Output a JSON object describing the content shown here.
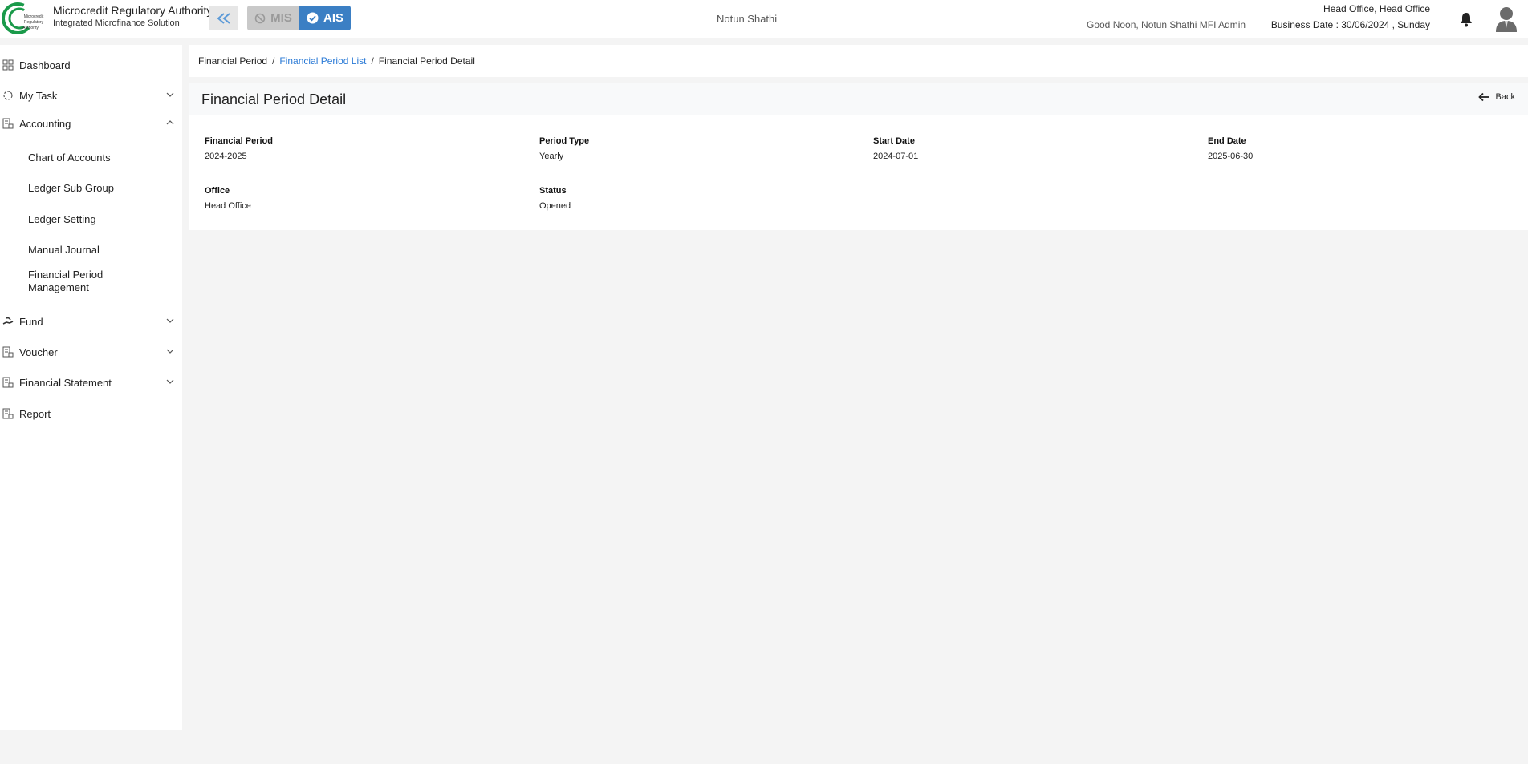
{
  "header": {
    "brand_title": "Microcredit Regulatory Authority",
    "brand_subtitle": "Integrated Microfinance Solution",
    "logo_text": "Microcredit Regulatory Authority",
    "mis_label": "MIS",
    "ais_label": "AIS",
    "org_name": "Notun Shathi",
    "greeting": "Good Noon, Notun Shathi MFI Admin",
    "office": "Head Office, Head Office",
    "business_date": "Business Date : 30/06/2024 , Sunday"
  },
  "sidebar": {
    "items": [
      {
        "label": "Dashboard",
        "icon": "grid-icon"
      },
      {
        "label": "My Task",
        "icon": "spinner-icon"
      },
      {
        "label": "Accounting",
        "icon": "ledger-icon"
      },
      {
        "label": "Fund",
        "icon": "hand-money-icon"
      },
      {
        "label": "Voucher",
        "icon": "ledger-icon"
      },
      {
        "label": "Financial Statement",
        "icon": "ledger-icon"
      },
      {
        "label": "Report",
        "icon": "ledger-icon"
      }
    ],
    "accounting_sub": [
      "Chart of Accounts",
      "Ledger Sub Group",
      "Ledger Setting",
      "Manual Journal",
      "Financial Period Management"
    ]
  },
  "breadcrumb": {
    "root": "Financial Period",
    "list": "Financial Period List",
    "current": "Financial Period Detail",
    "separator": "/"
  },
  "detail": {
    "title": "Financial Period Detail",
    "back_label": "Back",
    "fields": [
      {
        "label": "Financial Period",
        "value": "2024-2025"
      },
      {
        "label": "Period Type",
        "value": "Yearly"
      },
      {
        "label": "Start Date",
        "value": "2024-07-01"
      },
      {
        "label": "End Date",
        "value": "2025-06-30"
      },
      {
        "label": "Office",
        "value": "Head Office"
      },
      {
        "label": "Status",
        "value": "Opened"
      }
    ]
  },
  "colors": {
    "accent": "#3b7fc4",
    "link": "#2a7ad6",
    "logo_green": "#1a9a4a"
  }
}
